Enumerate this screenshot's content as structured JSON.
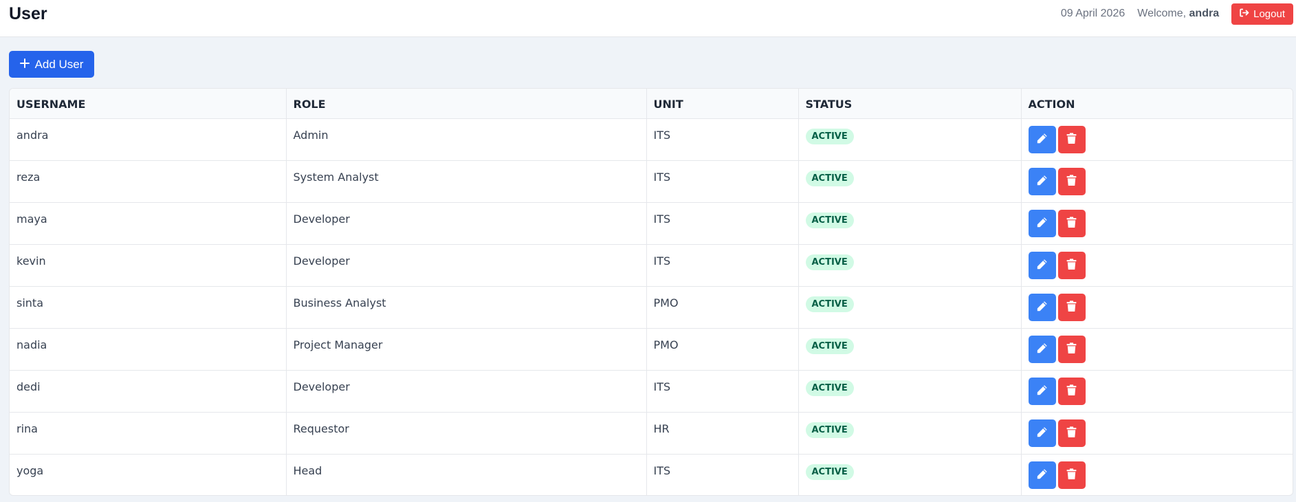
{
  "header": {
    "title": "User",
    "date": "09 April 2026",
    "welcome_prefix": "Welcome, ",
    "username": "andra",
    "logout_label": "Logout"
  },
  "toolbar": {
    "add_user_label": "Add User"
  },
  "table": {
    "columns": [
      "USERNAME",
      "ROLE",
      "UNIT",
      "STATUS",
      "ACTION"
    ],
    "rows": [
      {
        "username": "andra",
        "role": "Admin",
        "unit": "ITS",
        "status": "ACTIVE"
      },
      {
        "username": "reza",
        "role": "System Analyst",
        "unit": "ITS",
        "status": "ACTIVE"
      },
      {
        "username": "maya",
        "role": "Developer",
        "unit": "ITS",
        "status": "ACTIVE"
      },
      {
        "username": "kevin",
        "role": "Developer",
        "unit": "ITS",
        "status": "ACTIVE"
      },
      {
        "username": "sinta",
        "role": "Business Analyst",
        "unit": "PMO",
        "status": "ACTIVE"
      },
      {
        "username": "nadia",
        "role": "Project Manager",
        "unit": "PMO",
        "status": "ACTIVE"
      },
      {
        "username": "dedi",
        "role": "Developer",
        "unit": "ITS",
        "status": "ACTIVE"
      },
      {
        "username": "rina",
        "role": "Requestor",
        "unit": "HR",
        "status": "ACTIVE"
      },
      {
        "username": "yoga",
        "role": "Head",
        "unit": "ITS",
        "status": "ACTIVE"
      }
    ]
  },
  "icons": {
    "logout": "logout-icon",
    "add": "plus-icon",
    "edit": "pencil-icon",
    "delete": "trash-icon"
  },
  "colors": {
    "primary": "#2563eb",
    "edit": "#3b82f6",
    "danger": "#ef4444",
    "badge_bg": "#d1fae5",
    "badge_text": "#065f46"
  }
}
